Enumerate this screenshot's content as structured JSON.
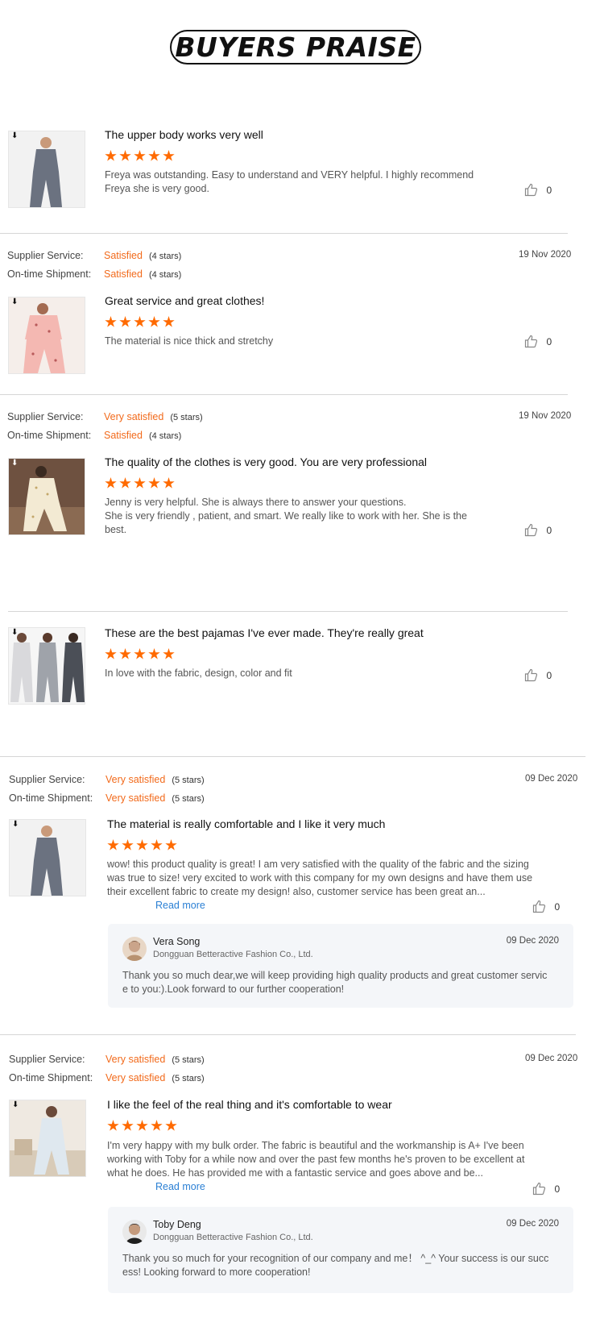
{
  "header": {
    "title": "BUYERS PRAISE"
  },
  "labels": {
    "supplier_service": "Supplier Service:",
    "ontime_shipment": "On-time Shipment:",
    "read_more": "Read more"
  },
  "reviews": [
    {
      "title": "The upper body works very well",
      "rating_stars": 5,
      "body": "Freya was outstanding. Easy to understand and VERY helpful. I highly recommend Freya she is very good.",
      "likes": "0"
    },
    {
      "supplier_service": "Satisfied",
      "supplier_stars": "(4 stars)",
      "ontime_shipment": "Satisfied",
      "ontime_stars": "(4 stars)",
      "date": "19 Nov 2020",
      "title": "Great service and great clothes!",
      "rating_stars": 5,
      "body": "The material is nice thick and stretchy",
      "likes": "0"
    },
    {
      "supplier_service": "Very satisfied",
      "supplier_stars": "(5 stars)",
      "ontime_shipment": "Satisfied",
      "ontime_stars": "(4 stars)",
      "date": "19 Nov 2020",
      "title": "The quality of the clothes is very good. You are very professional",
      "rating_stars": 5,
      "body": "Jenny is very helpful. She is always there to answer your questions.\nShe is  very friendly , patient, and smart. We really like to work with her. She is the best.",
      "likes": "0"
    },
    {
      "title": "These are the best pajamas I've ever made. They're really great",
      "rating_stars": 5,
      "body": "In love with the fabric, design,  color and fit",
      "likes": "0"
    },
    {
      "supplier_service": "Very satisfied",
      "supplier_stars": "(5 stars)",
      "ontime_shipment": "Very satisfied",
      "ontime_stars": "(5 stars)",
      "date": "09 Dec 2020",
      "title": "The material is really comfortable and I like it very much",
      "rating_stars": 5,
      "body": "wow! this product quality is great! I am very satisfied with the quality of the fabric and the sizing was true to size! very excited to work with this company for my own designs and have them use their excellent fabric to create my design! also, customer service has been great an...",
      "likes": "0",
      "reply": {
        "name": "Vera Song",
        "company": "Dongguan Betteractive Fashion Co., Ltd.",
        "date": "09 Dec 2020",
        "text": "Thank you so much dear,we will keep providing high quality products and great customer service to you:).Look forward to our further cooperation!"
      }
    },
    {
      "supplier_service": "Very satisfied",
      "supplier_stars": "(5 stars)",
      "ontime_shipment": "Very satisfied",
      "ontime_stars": "(5 stars)",
      "date": "09 Dec 2020",
      "title": "I like the feel of the real thing and it's comfortable to wear",
      "rating_stars": 5,
      "body": "I'm very happy with my bulk order. The fabric is beautiful and the workmanship is A+ I've been working with Toby for a while now and over the past few months he's proven to be excellent at what he does. He has provided me with a fantastic service and goes above and be...",
      "likes": "0",
      "reply": {
        "name": "Toby Deng",
        "company": "Dongguan Betteractive Fashion Co., Ltd.",
        "date": "09 Dec 2020",
        "text": "Thank you so much for your recognition of our company and me！ ^_^ Your success is our success! Looking forward to more cooperation!"
      }
    }
  ],
  "colors": {
    "accent_orange": "#f26a1b",
    "star_orange": "#ff6a00",
    "link_blue": "#2a7fd4"
  }
}
